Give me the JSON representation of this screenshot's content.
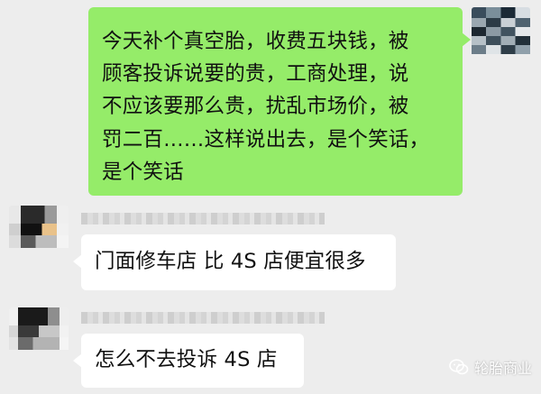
{
  "conversation": {
    "messages": [
      {
        "direction": "outgoing",
        "lines": [
          "今天补个真空胎，收费五块钱，被",
          "顾客投诉说要的贵，工商处理，说",
          "不应该要那么贵，扰乱市场价，被",
          "罚二百……这样说出去，是个笑话，",
          "是个笑话"
        ]
      },
      {
        "direction": "incoming",
        "text": "门面修车店 比 4S 店便宜很多"
      },
      {
        "direction": "incoming",
        "text": "怎么不去投诉 4S 店"
      }
    ]
  },
  "watermark": {
    "icon": "wechat-logo-icon",
    "text": "轮胎商业"
  },
  "colors": {
    "background": "#ededed",
    "outgoing_bubble": "#95ec69",
    "incoming_bubble": "#ffffff"
  }
}
